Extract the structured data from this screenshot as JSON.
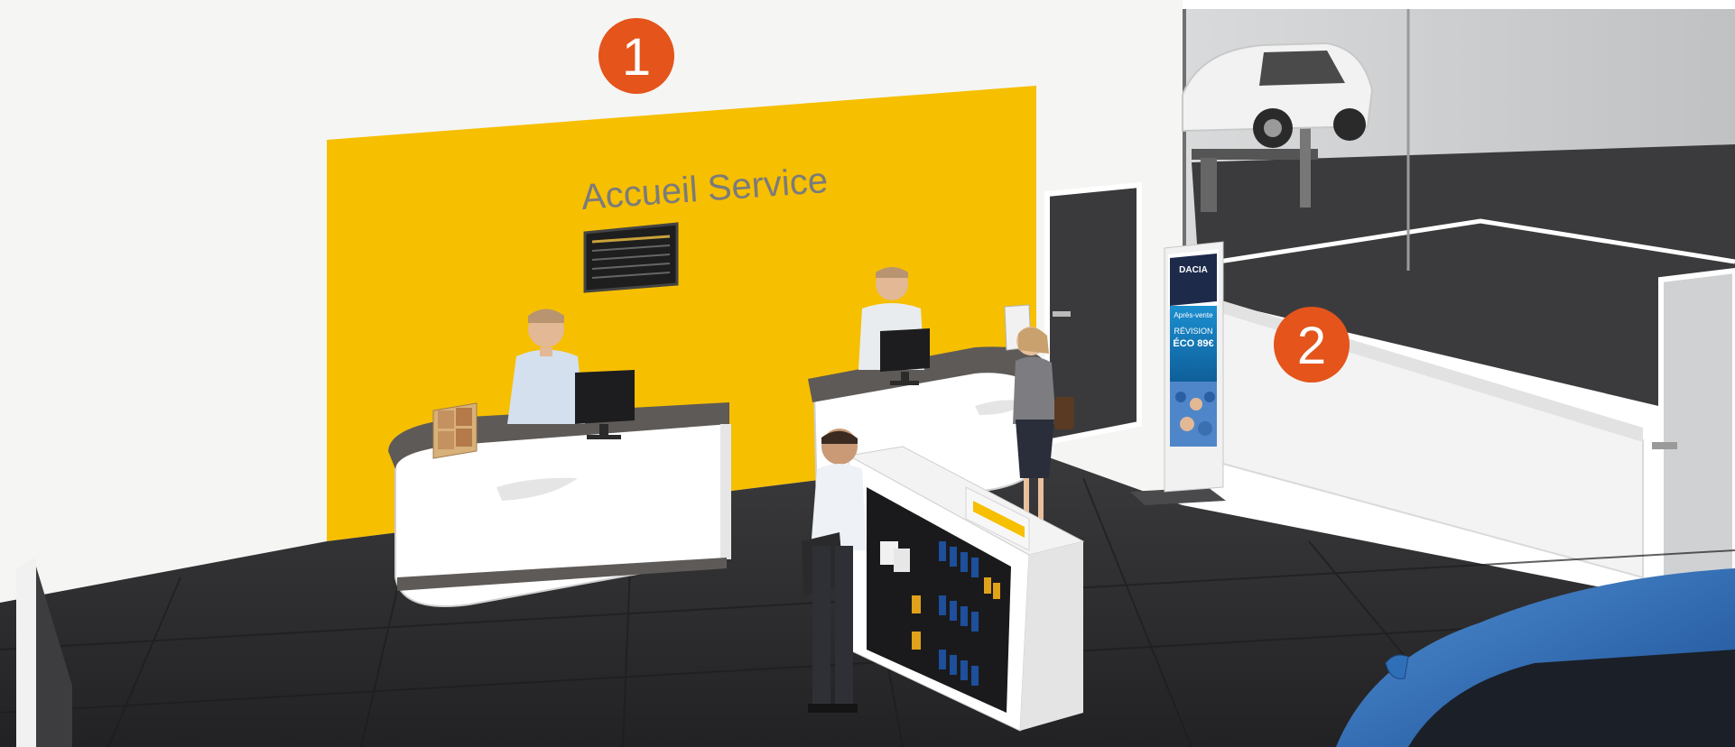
{
  "scene": {
    "wall_sign": "Accueil Service",
    "marker_1": "1",
    "marker_2": "2",
    "totem": {
      "brand": "DACIA",
      "section": "Après-vente",
      "offer_title": "RÉVISION",
      "offer_price": "ÉCO 89€"
    }
  },
  "colors": {
    "accent_yellow": "#f6bf00",
    "marker_orange": "#e4541b",
    "floor_dark": "#2b2b2d",
    "wall_white": "#f4f4f2",
    "dacia_blue": "#1c8fd0",
    "car_blue": "#2f6fb8"
  }
}
